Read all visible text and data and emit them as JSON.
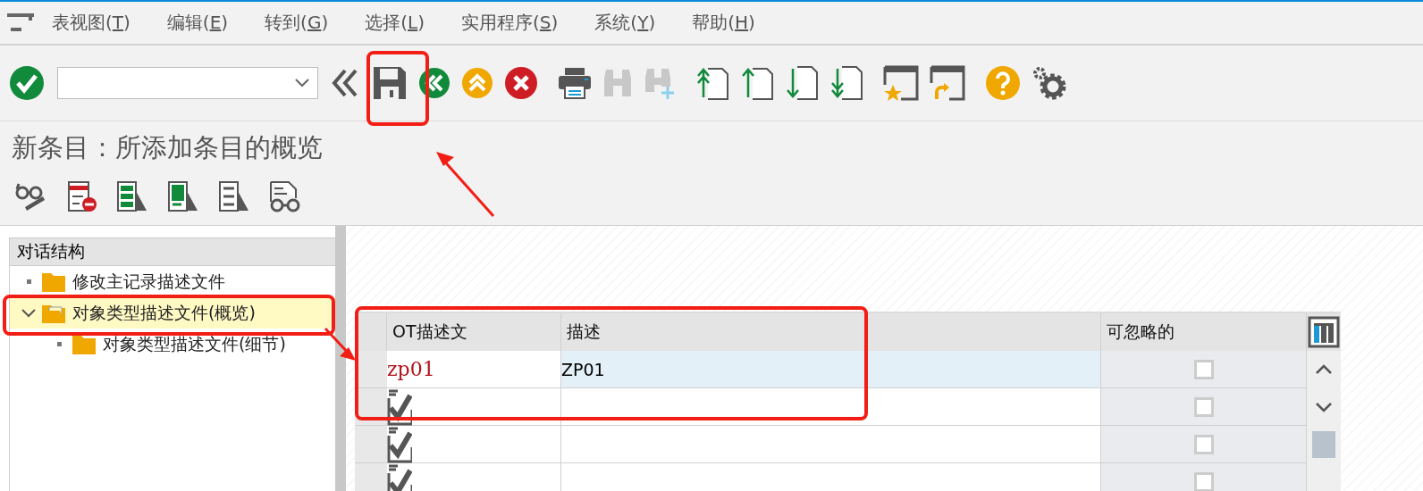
{
  "menu_bar": [
    {
      "label": "表视图(T)"
    },
    {
      "label": "编辑(E)"
    },
    {
      "label": "转到(G)"
    },
    {
      "label": "选择(L)"
    },
    {
      "label": "实用程序(S)"
    },
    {
      "label": "系统(Y)"
    },
    {
      "label": "帮助(H)"
    }
  ],
  "toolbar": [
    {
      "kind": "enter"
    },
    {
      "kind": "command-field"
    },
    {
      "kind": "collapse"
    },
    {
      "kind": "save"
    },
    {
      "kind": "back"
    },
    {
      "kind": "exit"
    },
    {
      "kind": "cancel"
    },
    {
      "kind": "print"
    },
    {
      "kind": "find",
      "disabled": true
    },
    {
      "kind": "find-next",
      "disabled": true
    },
    {
      "kind": "first-page"
    },
    {
      "kind": "prev-page"
    },
    {
      "kind": "next-page"
    },
    {
      "kind": "last-page"
    },
    {
      "kind": "new-session"
    },
    {
      "kind": "shortcut"
    },
    {
      "kind": "help"
    },
    {
      "kind": "settings"
    }
  ],
  "screen_title": "新条目：所添加条目的概览",
  "app_toolbar": [
    {
      "kind": "display-change"
    },
    {
      "kind": "delete"
    },
    {
      "kind": "select-all"
    },
    {
      "kind": "select-block"
    },
    {
      "kind": "deselect-all"
    },
    {
      "kind": "details"
    }
  ],
  "tree": {
    "header": "对话结构",
    "items": [
      {
        "label": "修改主记录描述文件",
        "expanded": false,
        "selected": false
      },
      {
        "label": "对象类型描述文件(概览)",
        "expanded": true,
        "selected": true,
        "children": [
          {
            "label": "对象类型描述文件(细节)",
            "expanded": false,
            "selected": false
          }
        ]
      }
    ]
  },
  "table": {
    "columns": [
      "OT描述文",
      "描述",
      "可忽略的"
    ],
    "rows": [
      {
        "kind": "entry",
        "ot": "zp01",
        "description": "ZP01",
        "ignorable": false
      },
      {
        "kind": "blank",
        "ignorable": false
      },
      {
        "kind": "blank",
        "ignorable": false
      },
      {
        "kind": "blank",
        "ignorable": false
      }
    ]
  },
  "annotations": [
    {
      "kind": "save-frame"
    },
    {
      "kind": "title-arrow"
    },
    {
      "kind": "tree-frame"
    },
    {
      "kind": "table-arrow"
    },
    {
      "kind": "table-frame"
    }
  ]
}
